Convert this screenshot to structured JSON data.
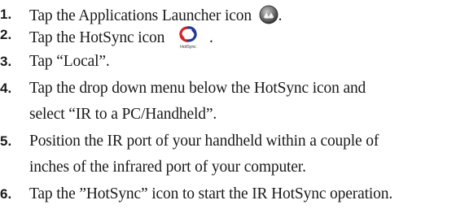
{
  "steps": [
    {
      "number": "1.",
      "text_before_icon": "Tap the Applications Launcher icon ",
      "icon": "applications-launcher-icon",
      "text_after_icon": "."
    },
    {
      "number": "2.",
      "text_before_icon": "Tap the HotSync icon ",
      "icon": "hotsync-icon",
      "icon_caption": "HotSync",
      "text_after_icon": "."
    },
    {
      "number": "3.",
      "text": "Tap “Local”."
    },
    {
      "number": "4.",
      "line1": "Tap the drop down menu below the HotSync icon and",
      "line2": "select “IR to a PC/Handheld”."
    },
    {
      "number": "5.",
      "line1": "Position the IR port of your handheld within a couple of",
      "line2": "inches of the infrared port of your computer."
    },
    {
      "number": "6.",
      "text": "Tap the ”HotSync” icon to start the IR HotSync operation."
    }
  ],
  "colors": {
    "text": "#1a1a1a",
    "hotsync_red": "#d2232a",
    "hotsync_blue": "#1f3a93"
  }
}
